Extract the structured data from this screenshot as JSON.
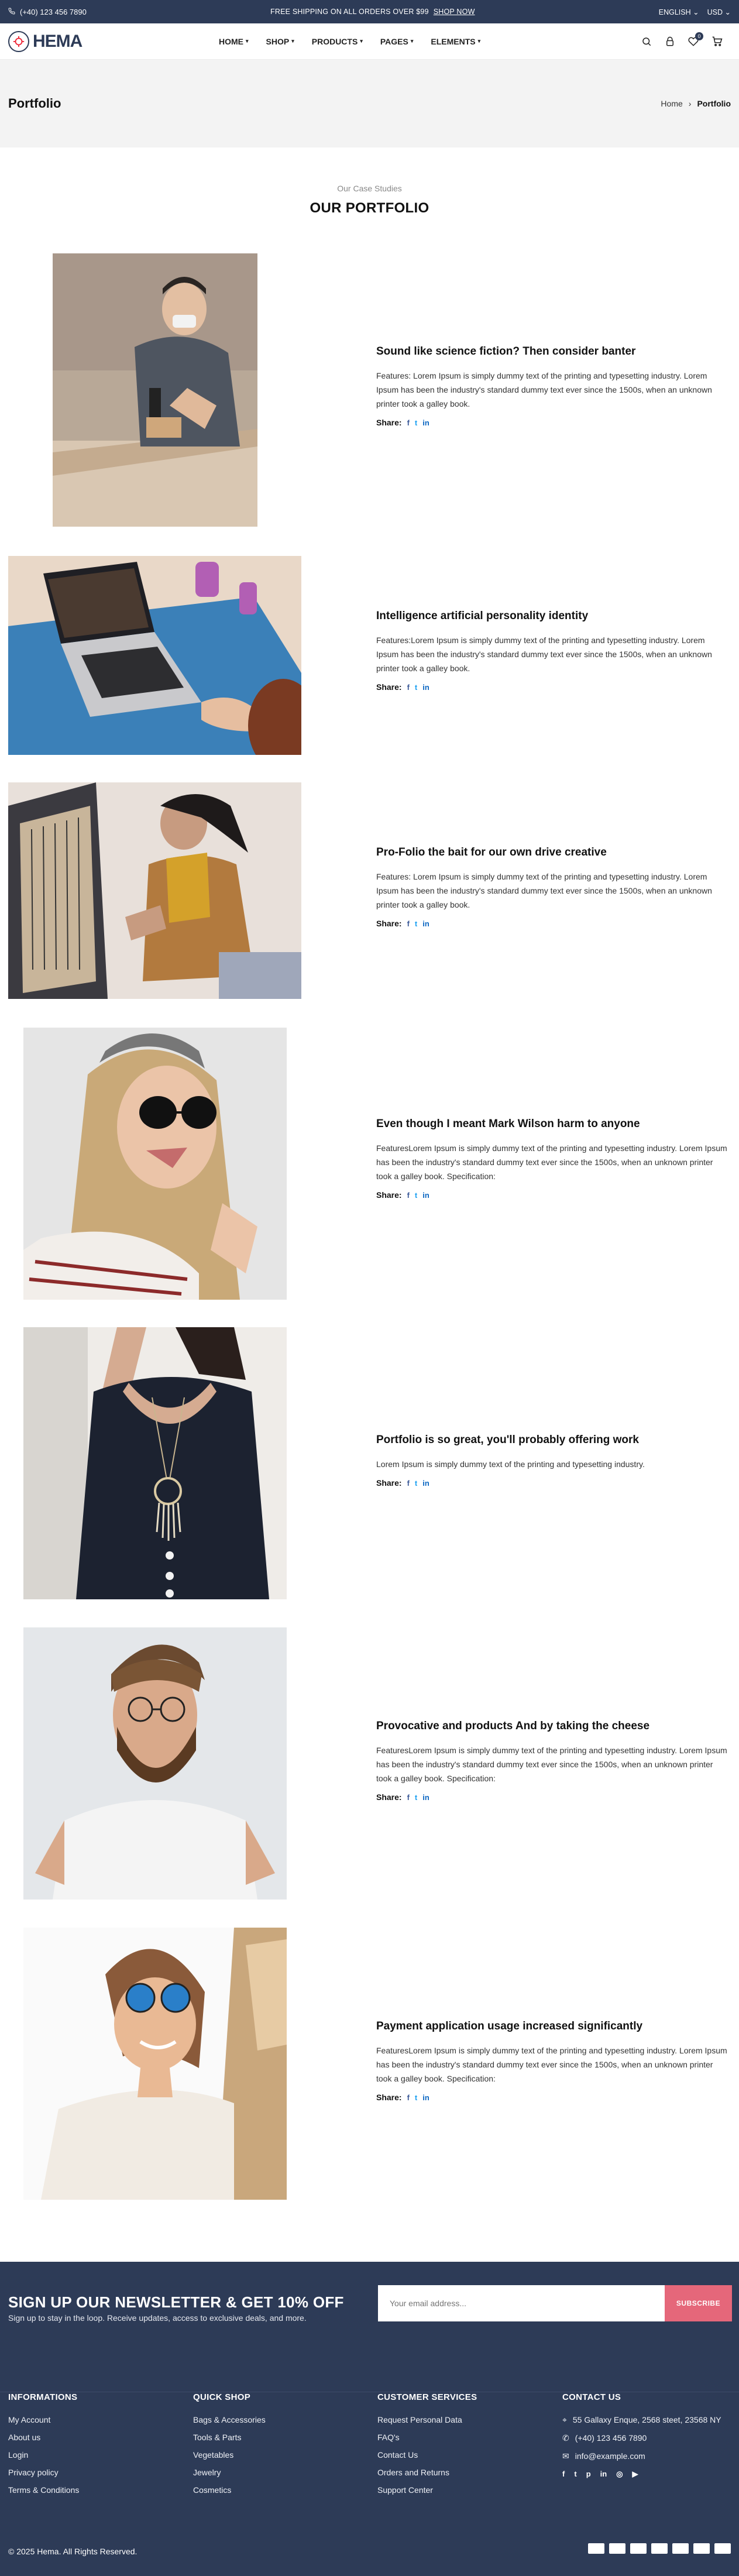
{
  "topbar": {
    "phone": "(+40) 123 456 7890",
    "promo": "FREE SHIPPING ON ALL ORDERS OVER $99",
    "promo_link": "SHOP NOW",
    "language": "ENGLISH",
    "currency": "USD"
  },
  "header": {
    "logo_text": "HEMA",
    "nav": [
      "HOME",
      "SHOP",
      "PRODUCTS",
      "PAGES",
      "ELEMENTS"
    ],
    "wishlist_count": "0"
  },
  "title_band": {
    "title": "Portfolio",
    "crumb_home": "Home",
    "crumb_current": "Portfolio"
  },
  "section": {
    "subtitle": "Our Case Studies",
    "title": "OUR PORTFOLIO"
  },
  "share_label": "Share:",
  "items": [
    {
      "title": "Sound like science fiction? Then consider banter",
      "text": "Features: Lorem Ipsum is simply dummy text of the printing and typesetting industry. Lorem Ipsum has been the industry's standard dummy text ever since the 1500s, when an unknown printer took a galley book."
    },
    {
      "title": "Intelligence artificial personality identity",
      "text": "Features:Lorem Ipsum is simply dummy text of the printing and typesetting industry. Lorem Ipsum has been the industry's standard dummy text ever since the 1500s, when an unknown printer took a galley book."
    },
    {
      "title": "Pro-Folio the bait for our own drive creative",
      "text": "Features: Lorem Ipsum is simply dummy text of the printing and typesetting industry. Lorem Ipsum has been the industry's standard dummy text ever since the 1500s, when an unknown printer took a galley book."
    },
    {
      "title": "Even though I meant Mark Wilson harm to anyone",
      "text": "FeaturesLorem Ipsum is simply dummy text of the printing and typesetting industry. Lorem Ipsum has been the industry's standard dummy text ever since the 1500s, when an unknown printer took a galley book. Specification:"
    },
    {
      "title": "Portfolio is so great, you'll probably offering work",
      "text": "Lorem Ipsum is simply dummy text of the printing and typesetting industry."
    },
    {
      "title": "Provocative and products And by taking the cheese",
      "text": "FeaturesLorem Ipsum is simply dummy text of the printing and typesetting industry. Lorem Ipsum has been the industry's standard dummy text ever since the 1500s, when an unknown printer took a galley book. Specification:"
    },
    {
      "title": "Payment application usage increased significantly",
      "text": "FeaturesLorem Ipsum is simply dummy text of the printing and typesetting industry. Lorem Ipsum has been the industry's standard dummy text ever since the 1500s, when an unknown printer took a galley book. Specification:"
    }
  ],
  "newsletter": {
    "title": "SIGN UP OUR NEWSLETTER & GET 10% OFF",
    "subtitle": "Sign up to stay in the loop. Receive updates, access to exclusive deals, and more.",
    "placeholder": "Your email address...",
    "button": "SUBSCRIBE"
  },
  "footer": {
    "informations": {
      "title": "INFORMATIONS",
      "links": [
        "My Account",
        "About us",
        "Login",
        "Privacy policy",
        "Terms & Conditions"
      ]
    },
    "quick_shop": {
      "title": "QUICK SHOP",
      "links": [
        "Bags & Accessories",
        "Tools & Parts",
        "Vegetables",
        "Jewelry",
        "Cosmetics"
      ]
    },
    "customer_services": {
      "title": "CUSTOMER SERVICES",
      "links": [
        "Request Personal Data",
        "FAQ's",
        "Contact Us",
        "Orders and Returns",
        "Support Center"
      ]
    },
    "contact": {
      "title": "CONTACT US",
      "address": "55 Gallaxy Enque, 2568 steet, 23568 NY",
      "phone": "(+40) 123 456 7890",
      "email": "info@example.com"
    },
    "copyright": "© 2025 Hema. All Rights Reserved."
  }
}
